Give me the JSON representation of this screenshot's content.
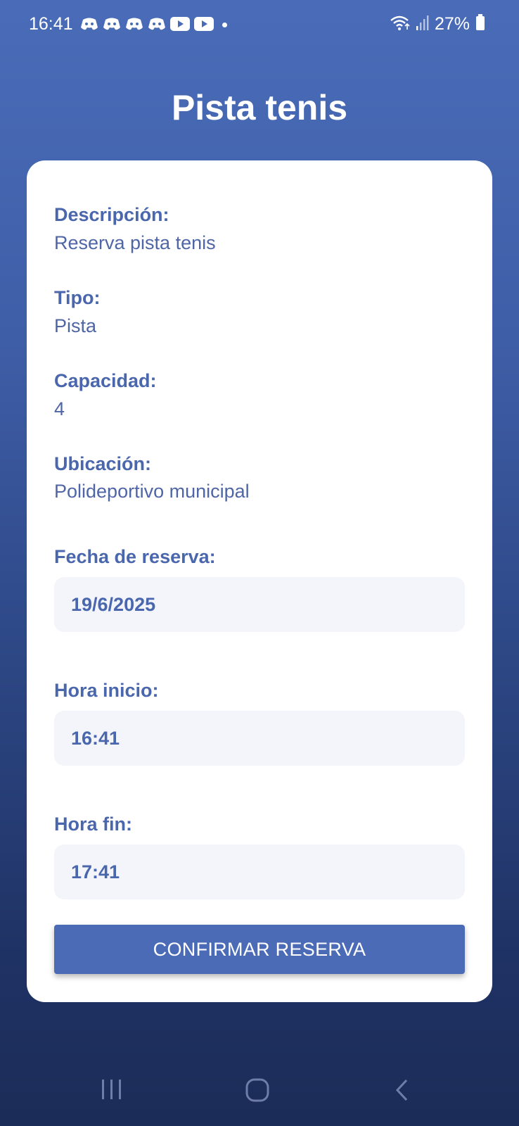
{
  "status_bar": {
    "time": "16:41",
    "battery": "27%",
    "notification_icons": [
      "discord-icon",
      "discord-icon",
      "discord-icon",
      "discord-icon",
      "youtube-icon",
      "youtube-icon"
    ]
  },
  "header": {
    "title": "Pista tenis"
  },
  "details": {
    "description_label": "Descripción:",
    "description_value": "Reserva pista tenis",
    "type_label": "Tipo:",
    "type_value": "Pista",
    "capacity_label": "Capacidad:",
    "capacity_value": "4",
    "location_label": "Ubicación:",
    "location_value": "Polideportivo municipal"
  },
  "form": {
    "date_label": "Fecha de reserva:",
    "date_value": "19/6/2025",
    "start_label": "Hora inicio:",
    "start_value": "16:41",
    "end_label": "Hora fin:",
    "end_value": "17:41",
    "confirm_label": "CONFIRMAR RESERVA"
  },
  "colors": {
    "accent": "#4b6bb7",
    "label": "#4a67ad",
    "input_bg": "#f4f5fa"
  }
}
